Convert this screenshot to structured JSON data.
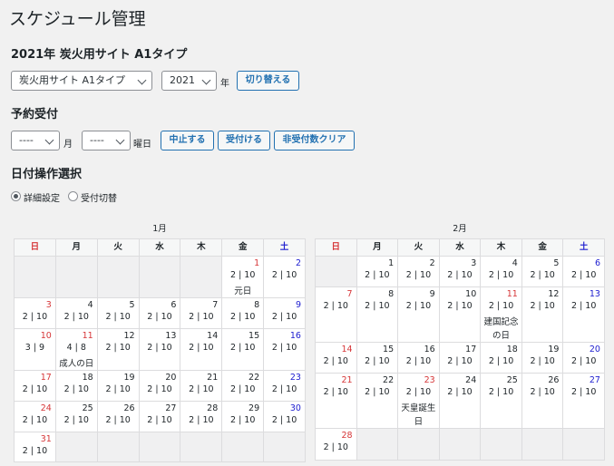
{
  "page": {
    "title": "スケジュール管理"
  },
  "site_section": {
    "heading": "2021年 炭火用サイト A1タイプ",
    "site_select": "炭火用サイト A1タイプ",
    "year_select": "2021",
    "year_suffix": "年",
    "switch_button": "切り替える"
  },
  "reservation": {
    "heading": "予約受付",
    "month_select": "----",
    "month_suffix": "月",
    "weekday_select": "----",
    "weekday_suffix": "曜日",
    "stop_button": "中止する",
    "accept_button": "受付ける",
    "clear_button": "非受付数クリア"
  },
  "date_ops": {
    "heading": "日付操作選択",
    "option_detail": "詳細設定",
    "option_toggle": "受付切替",
    "selected": "詳細設定"
  },
  "weekdays": [
    "日",
    "月",
    "火",
    "水",
    "木",
    "金",
    "土"
  ],
  "calendars": [
    {
      "label": "1月",
      "weeks": [
        [
          null,
          null,
          null,
          null,
          null,
          {
            "d": "1",
            "v": "2 | 10",
            "h": "元日",
            "c": "hol"
          },
          {
            "d": "2",
            "v": "2 | 10"
          }
        ],
        [
          {
            "d": "3",
            "v": "2 | 10"
          },
          {
            "d": "4",
            "v": "2 | 10"
          },
          {
            "d": "5",
            "v": "2 | 10"
          },
          {
            "d": "6",
            "v": "2 | 10"
          },
          {
            "d": "7",
            "v": "2 | 10"
          },
          {
            "d": "8",
            "v": "2 | 10"
          },
          {
            "d": "9",
            "v": "2 | 10"
          }
        ],
        [
          {
            "d": "10",
            "v": "3 | 9"
          },
          {
            "d": "11",
            "v": "4 | 8",
            "h": "成人の日",
            "c": "hol"
          },
          {
            "d": "12",
            "v": "2 | 10"
          },
          {
            "d": "13",
            "v": "2 | 10"
          },
          {
            "d": "14",
            "v": "2 | 10"
          },
          {
            "d": "15",
            "v": "2 | 10"
          },
          {
            "d": "16",
            "v": "2 | 10"
          }
        ],
        [
          {
            "d": "17",
            "v": "2 | 10"
          },
          {
            "d": "18",
            "v": "2 | 10"
          },
          {
            "d": "19",
            "v": "2 | 10"
          },
          {
            "d": "20",
            "v": "2 | 10"
          },
          {
            "d": "21",
            "v": "2 | 10"
          },
          {
            "d": "22",
            "v": "2 | 10"
          },
          {
            "d": "23",
            "v": "2 | 10"
          }
        ],
        [
          {
            "d": "24",
            "v": "2 | 10"
          },
          {
            "d": "25",
            "v": "2 | 10"
          },
          {
            "d": "26",
            "v": "2 | 10"
          },
          {
            "d": "27",
            "v": "2 | 10"
          },
          {
            "d": "28",
            "v": "2 | 10"
          },
          {
            "d": "29",
            "v": "2 | 10"
          },
          {
            "d": "30",
            "v": "2 | 10"
          }
        ],
        [
          {
            "d": "31",
            "v": "2 | 10"
          }
        ]
      ]
    },
    {
      "label": "2月",
      "weeks": [
        [
          null,
          {
            "d": "1",
            "v": "2 | 10"
          },
          {
            "d": "2",
            "v": "2 | 10"
          },
          {
            "d": "3",
            "v": "2 | 10"
          },
          {
            "d": "4",
            "v": "2 | 10"
          },
          {
            "d": "5",
            "v": "2 | 10"
          },
          {
            "d": "6",
            "v": "2 | 10"
          }
        ],
        [
          {
            "d": "7",
            "v": "2 | 10"
          },
          {
            "d": "8",
            "v": "2 | 10"
          },
          {
            "d": "9",
            "v": "2 | 10"
          },
          {
            "d": "10",
            "v": "2 | 10"
          },
          {
            "d": "11",
            "v": "2 | 10",
            "h": "建国記念の日",
            "c": "hol"
          },
          {
            "d": "12",
            "v": "2 | 10"
          },
          {
            "d": "13",
            "v": "2 | 10"
          }
        ],
        [
          {
            "d": "14",
            "v": "2 | 10"
          },
          {
            "d": "15",
            "v": "2 | 10"
          },
          {
            "d": "16",
            "v": "2 | 10"
          },
          {
            "d": "17",
            "v": "2 | 10"
          },
          {
            "d": "18",
            "v": "2 | 10"
          },
          {
            "d": "19",
            "v": "2 | 10"
          },
          {
            "d": "20",
            "v": "2 | 10"
          }
        ],
        [
          {
            "d": "21",
            "v": "2 | 10"
          },
          {
            "d": "22",
            "v": "2 | 10"
          },
          {
            "d": "23",
            "v": "2 | 10",
            "h": "天皇誕生日",
            "c": "hol"
          },
          {
            "d": "24",
            "v": "2 | 10"
          },
          {
            "d": "25",
            "v": "2 | 10"
          },
          {
            "d": "26",
            "v": "2 | 10"
          },
          {
            "d": "27",
            "v": "2 | 10"
          }
        ],
        [
          {
            "d": "28",
            "v": "2 | 10"
          }
        ]
      ]
    }
  ],
  "colors": {
    "sunday": "#d63638",
    "saturday": "#2020d0",
    "button": "#2271b1"
  }
}
